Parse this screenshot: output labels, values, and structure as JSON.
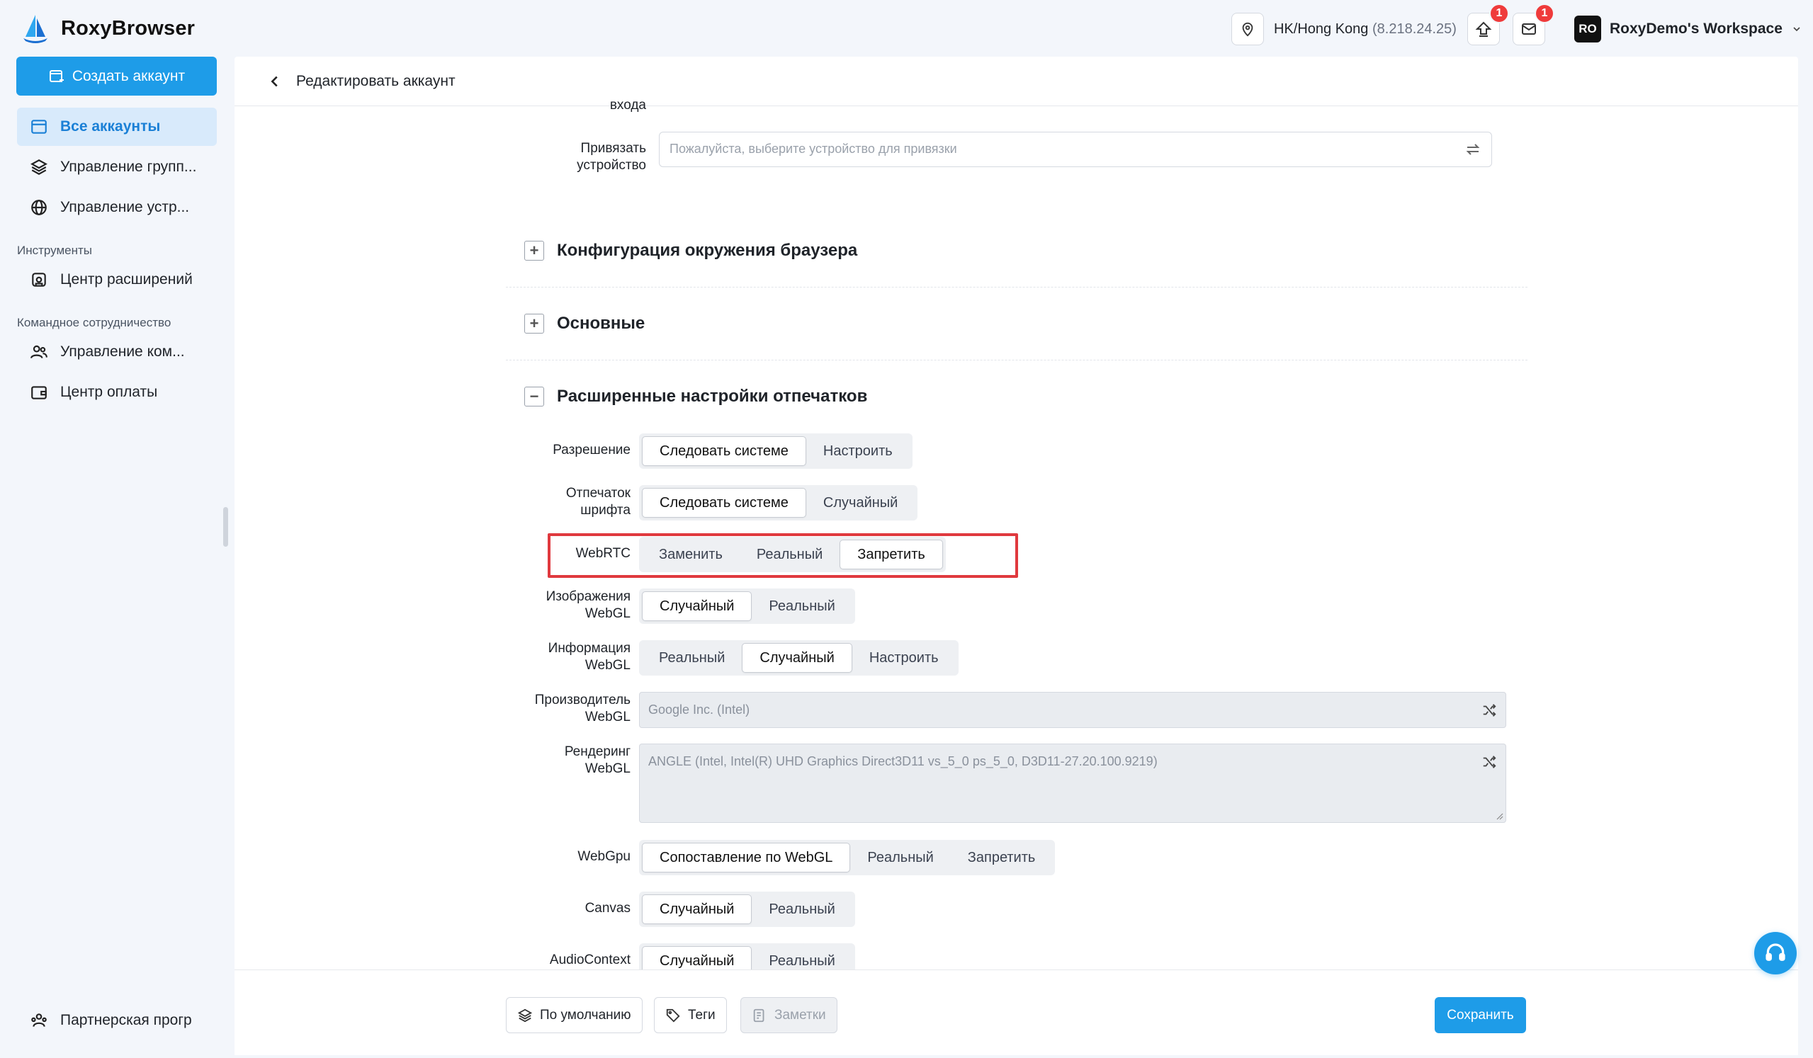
{
  "app": {
    "name": "RoxyBrowser"
  },
  "topbar": {
    "proxy_location": "HK/Hong Kong",
    "proxy_ip": "(8.218.24.25)",
    "update_badge": "1",
    "mail_badge": "1",
    "workspace_initials": "RO",
    "workspace_name": "RoxyDemo's Workspace"
  },
  "sidebar": {
    "create_label": "Создать аккаунт",
    "items": [
      {
        "label": "Все аккаунты",
        "icon": "browser-window-icon",
        "active": true
      },
      {
        "label": "Управление групп...",
        "icon": "layers-icon"
      },
      {
        "label": "Управление устр...",
        "icon": "globe-icon"
      }
    ],
    "section_tools": "Инструменты",
    "tools_items": [
      {
        "label": "Центр расширений",
        "icon": "extension-icon"
      }
    ],
    "section_team": "Командное сотрудничество",
    "team_items": [
      {
        "label": "Управление ком...",
        "icon": "users-icon"
      },
      {
        "label": "Центр оплаты",
        "icon": "wallet-icon"
      }
    ],
    "partner_label": "Партнерская прогр"
  },
  "page": {
    "title": "Редактировать аккаунт",
    "cut_label": "входа",
    "bind_device": {
      "label_line1": "Привязать",
      "label_line2": "устройство",
      "placeholder": "Пожалуйста, выберите устройство для привязки"
    },
    "sections": {
      "browser_env": "Конфигурация окружения браузера",
      "basic": "Основные",
      "advanced": "Расширенные настройки отпечатков"
    },
    "fields": {
      "resolution": {
        "label": "Разрешение",
        "options": [
          "Следовать системе",
          "Настроить"
        ],
        "selected": 0
      },
      "font": {
        "label_line1": "Отпечаток",
        "label_line2": "шрифта",
        "options": [
          "Следовать системе",
          "Случайный"
        ],
        "selected": 0
      },
      "webrtc": {
        "label": "WebRTC",
        "options": [
          "Заменить",
          "Реальный",
          "Запретить"
        ],
        "selected": 2
      },
      "webgl_image": {
        "label_line1": "Изображения",
        "label_line2": "WebGL",
        "options": [
          "Случайный",
          "Реальный"
        ],
        "selected": 0
      },
      "webgl_info": {
        "label_line1": "Информация",
        "label_line2": "WebGL",
        "options": [
          "Реальный",
          "Случайный",
          "Настроить"
        ],
        "selected": 1
      },
      "webgl_vendor": {
        "label_line1": "Производитель",
        "label_line2": "WebGL",
        "value": "Google Inc. (Intel)"
      },
      "webgl_renderer": {
        "label_line1": "Рендеринг",
        "label_line2": "WebGL",
        "value": "ANGLE (Intel, Intel(R) UHD Graphics Direct3D11 vs_5_0 ps_5_0, D3D11-27.20.100.9219)"
      },
      "webgpu": {
        "label": "WebGpu",
        "options": [
          "Сопоставление по WebGL",
          "Реальный",
          "Запретить"
        ],
        "selected": 0
      },
      "canvas": {
        "label": "Canvas",
        "options": [
          "Случайный",
          "Реальный"
        ],
        "selected": 0
      },
      "audio": {
        "label": "AudioContext",
        "options": [
          "Случайный",
          "Реальный"
        ],
        "selected": 0
      }
    }
  },
  "footer": {
    "default_label": "По умолчанию",
    "tags_label": "Теги",
    "notes_label": "Заметки",
    "save_label": "Сохранить"
  },
  "colors": {
    "accent": "#1e9ce8",
    "highlight": "#e0393e",
    "active_bg": "#d8eafb"
  }
}
